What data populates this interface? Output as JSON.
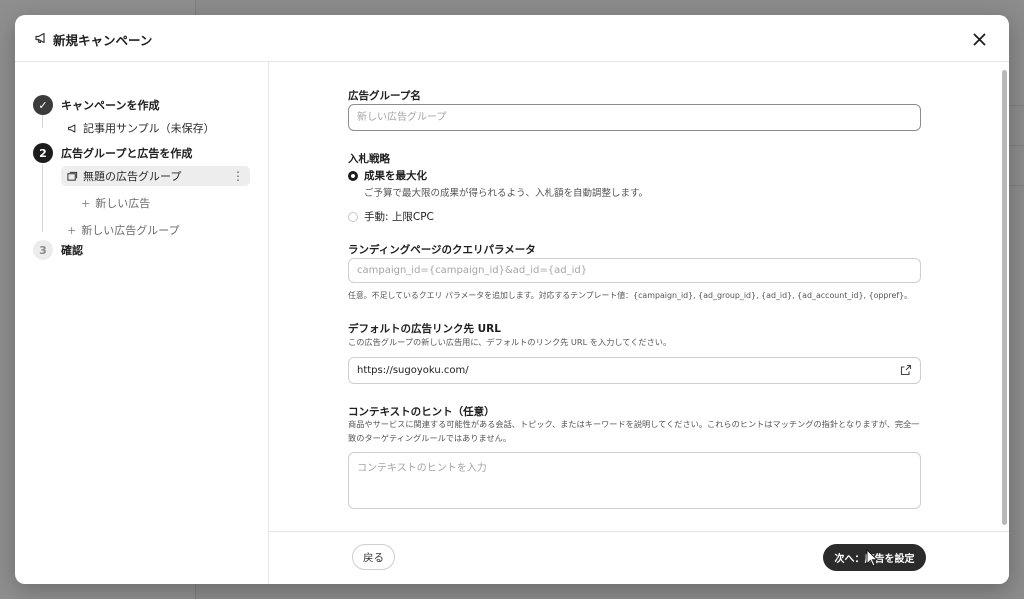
{
  "modal": {
    "title": "新規キャンペーン",
    "icon": "megaphone-icon"
  },
  "steps": [
    {
      "index": "✓",
      "label": "キャンペーンを作成",
      "state": "done"
    },
    {
      "index": "2",
      "label": "広告グループと広告を作成",
      "state": "active"
    },
    {
      "index": "3",
      "label": "確認",
      "state": "pending"
    }
  ],
  "step_items": {
    "campaign_name": "記事用サンプル（未保存）",
    "ad_group": "無題の広告グループ",
    "add_ad": "新しい広告",
    "add_ad_group": "新しい広告グループ"
  },
  "form": {
    "ad_group_name": {
      "label": "広告グループ名",
      "placeholder": "新しい広告グループ",
      "value": ""
    },
    "bid_strategy": {
      "label": "入札戦略",
      "options": [
        {
          "label": "成果を最大化",
          "description": "ご予算で最大限の成果が得られるよう、入札額を自動調整します。",
          "checked": true
        },
        {
          "label": "手動: 上限CPC",
          "description": "",
          "checked": false
        }
      ]
    },
    "query_params": {
      "label": "ランディングページのクエリパラメータ",
      "placeholder": "campaign_id={campaign_id}&ad_id={ad_id}",
      "help": "任意。不足しているクエリ パラメータを追加します。対応するテンプレート値：{campaign_id}, {ad_group_id}, {ad_id}, {ad_account_id}, {oppref}。"
    },
    "default_url": {
      "label": "デフォルトの広告リンク先 URL",
      "help": "この広告グループの新しい広告用に、デフォルトのリンク先 URL を入力してください。",
      "value": "https://sugoyoku.com/"
    },
    "context_hints": {
      "label": "コンテキストのヒント（任意）",
      "help": "商品やサービスに関連する可能性がある会話、トピック、またはキーワードを説明してください。これらのヒントはマッチングの指針となりますが、完全一致のターゲティングルールではありません。",
      "placeholder": "コンテキストのヒントを入力"
    }
  },
  "footer": {
    "back_label": "戻る",
    "next_label": "次へ：広告を設定"
  },
  "colors": {
    "primary": "#2b2b2b",
    "overlay": "#8f8f8f"
  }
}
